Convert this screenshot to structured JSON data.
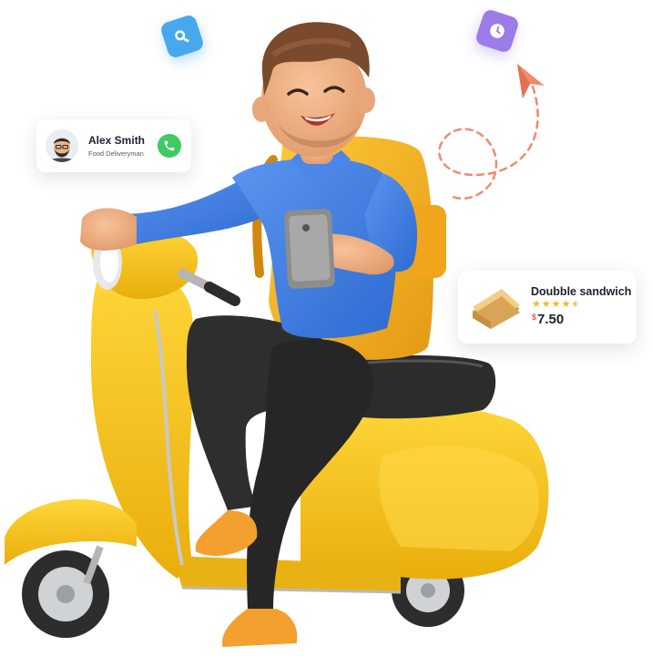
{
  "contact_card": {
    "name": "Alex Smith",
    "role": "Food Deliveryman",
    "avatar_icon": "avatar-icon",
    "call_icon": "phone-icon",
    "call_color": "#3fcb62"
  },
  "food_card": {
    "item_name": "Doubble sandwich",
    "rating": 4.5,
    "currency": "$",
    "price": "7.50",
    "thumb_icon": "sandwich-icon"
  },
  "badges": {
    "search": {
      "icon": "search-icon",
      "color": "#47a8ee"
    },
    "clock": {
      "icon": "clock-icon",
      "color": "#9b7ce9"
    }
  },
  "illustration": {
    "scooter_color": "#f2c21e",
    "shirt_color": "#3f7fe0",
    "backpack_color": "#f3b325",
    "arrow_color": "#f2896b"
  }
}
